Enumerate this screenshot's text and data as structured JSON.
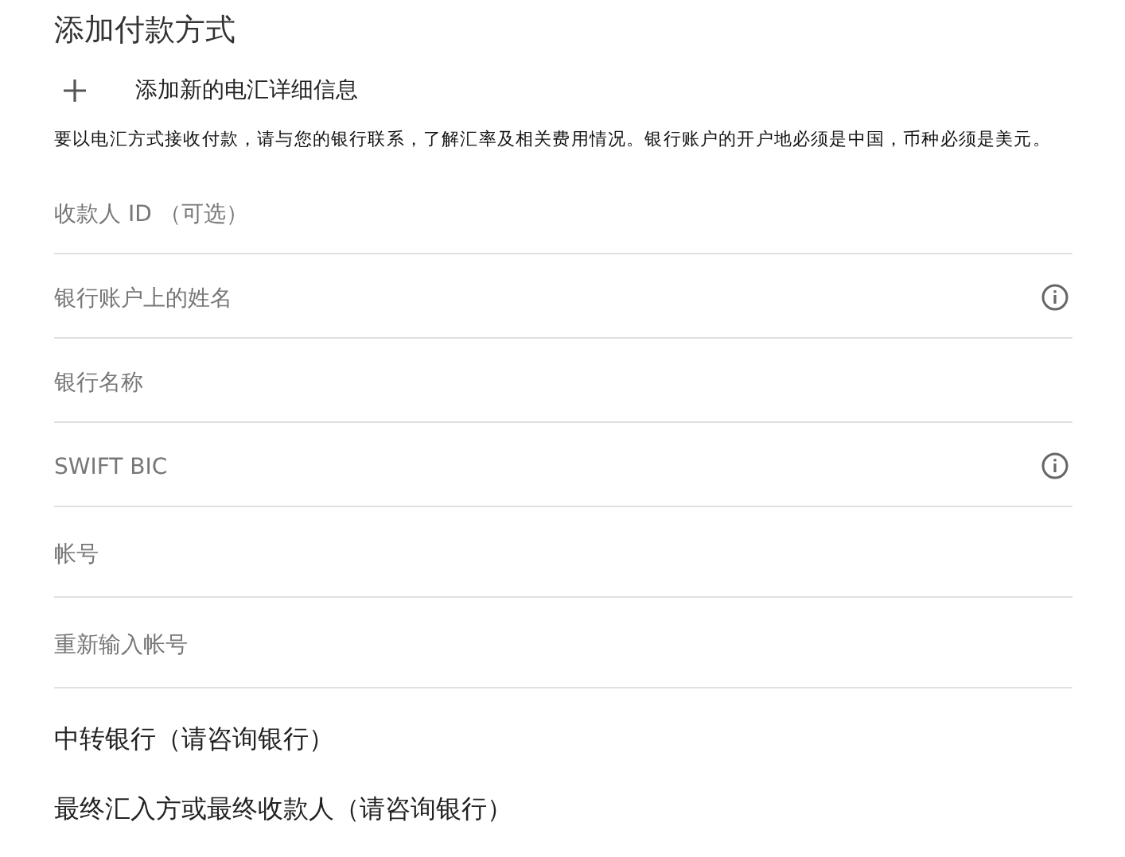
{
  "title": "添加付款方式",
  "add_link": {
    "label": "添加新的电汇详细信息"
  },
  "notice": "要以电汇方式接收付款，请与您的银行联系，了解汇率及相关费用情况。银行账户的开户地必须是中国，币种必须是美元。",
  "fields": [
    {
      "placeholder": "收款人 ID （可选）",
      "info": false
    },
    {
      "placeholder": "银行账户上的姓名",
      "info": true
    },
    {
      "placeholder": "银行名称",
      "info": false
    },
    {
      "placeholder": "SWIFT BIC",
      "info": true
    },
    {
      "placeholder": "帐号",
      "info": false
    },
    {
      "placeholder": "重新输入帐号",
      "info": false
    }
  ],
  "sections": [
    "中转银行（请咨询银行）",
    "最终汇入方或最终收款人（请咨询银行）"
  ]
}
